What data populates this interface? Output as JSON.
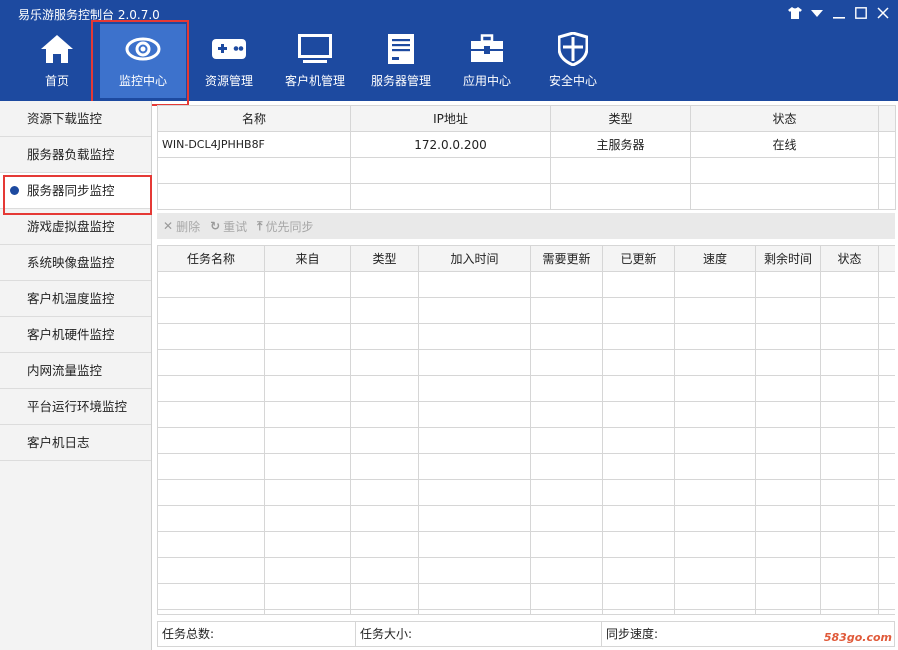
{
  "app": {
    "title": "易乐游服务控制台 2.0.7.0"
  },
  "nav": [
    {
      "label": "首页",
      "icon": "home-icon"
    },
    {
      "label": "监控中心",
      "icon": "eye-icon",
      "active": true
    },
    {
      "label": "资源管理",
      "icon": "gamepad-icon"
    },
    {
      "label": "客户机管理",
      "icon": "monitor-icon"
    },
    {
      "label": "服务器管理",
      "icon": "server-icon"
    },
    {
      "label": "应用中心",
      "icon": "toolbox-icon"
    },
    {
      "label": "安全中心",
      "icon": "shield-icon"
    }
  ],
  "sidebar": [
    "资源下载监控",
    "服务器负载监控",
    "服务器同步监控",
    "游戏虚拟盘监控",
    "系统映像盘监控",
    "客户机温度监控",
    "客户机硬件监控",
    "内网流量监控",
    "平台运行环境监控",
    "客户机日志"
  ],
  "server_table": {
    "headers": [
      "名称",
      "IP地址",
      "类型",
      "状态"
    ],
    "rows": [
      [
        "WIN-DCL4JPHHB8F",
        "172.0.0.200",
        "主服务器",
        "在线"
      ]
    ]
  },
  "toolbar": {
    "delete": "删除",
    "retry": "重试",
    "priority_sync": "优先同步"
  },
  "task_table": {
    "headers": [
      "任务名称",
      "来自",
      "类型",
      "加入时间",
      "需要更新",
      "已更新",
      "速度",
      "剩余时间",
      "状态"
    ]
  },
  "status": {
    "total": "任务总数:",
    "size": "任务大小:",
    "speed": "同步速度:"
  },
  "watermark": "583go.com"
}
